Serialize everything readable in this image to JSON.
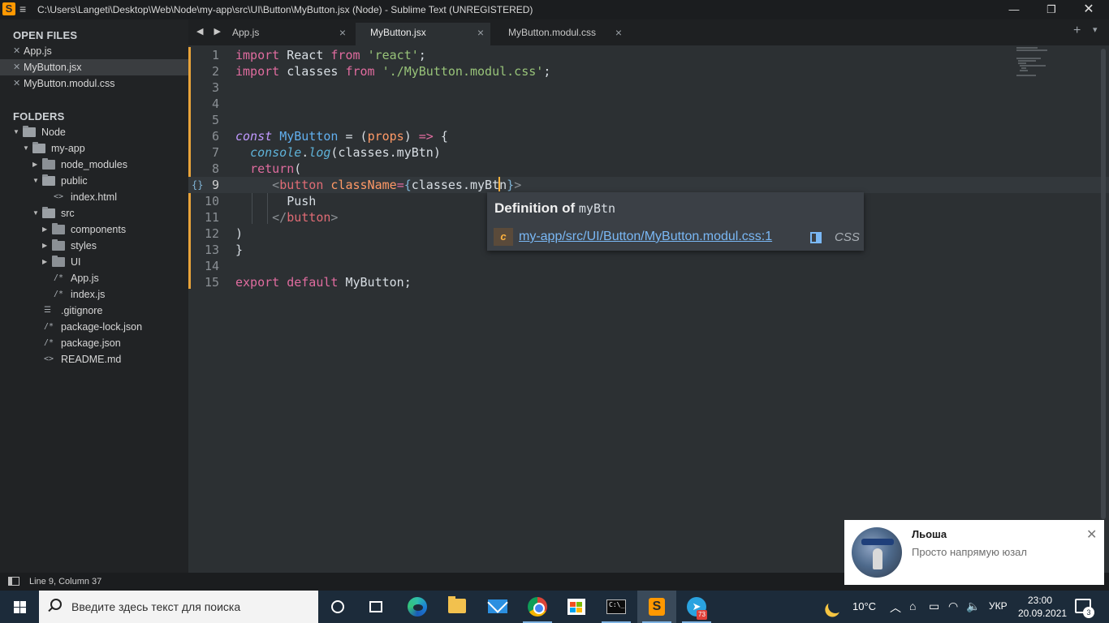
{
  "window": {
    "title": "C:\\Users\\Langeti\\Desktop\\Web\\Node\\my-app\\src\\UI\\Button\\MyButton.jsx (Node) - Sublime Text (UNREGISTERED)",
    "app_icon_glyph": "S",
    "menu_glyph": "≡",
    "minimize_glyph": "—",
    "maximize_glyph": "❐",
    "close_glyph": "✕"
  },
  "sidebar": {
    "open_files_heading": "OPEN FILES",
    "open_files": [
      {
        "label": "App.js",
        "active": false
      },
      {
        "label": "MyButton.jsx",
        "active": true
      },
      {
        "label": "MyButton.modul.css",
        "active": false
      }
    ],
    "close_glyph": "✕",
    "folders_heading": "FOLDERS",
    "tree": [
      {
        "label": "Node",
        "kind": "folder-open"
      },
      {
        "label": "my-app",
        "kind": "folder-open"
      },
      {
        "label": "node_modules",
        "kind": "folder"
      },
      {
        "label": "public",
        "kind": "folder-open"
      },
      {
        "label": "index.html",
        "kind": "file-markup",
        "icon_glyph": "<>"
      },
      {
        "label": "src",
        "kind": "folder-open"
      },
      {
        "label": "components",
        "kind": "folder"
      },
      {
        "label": "styles",
        "kind": "folder"
      },
      {
        "label": "UI",
        "kind": "folder"
      },
      {
        "label": "App.js",
        "kind": "file-script",
        "icon_glyph": "/*"
      },
      {
        "label": "index.js",
        "kind": "file-script",
        "icon_glyph": "/*"
      },
      {
        "label": ".gitignore",
        "kind": "file-text",
        "icon_glyph": "☰"
      },
      {
        "label": "package-lock.json",
        "kind": "file-script",
        "icon_glyph": "/*"
      },
      {
        "label": "package.json",
        "kind": "file-script",
        "icon_glyph": "/*"
      },
      {
        "label": "README.md",
        "kind": "file-markup",
        "icon_glyph": "<>"
      }
    ]
  },
  "tabs": {
    "nav_glyph": "◀ ▶",
    "items": [
      {
        "label": "App.js",
        "active": false
      },
      {
        "label": "MyButton.jsx",
        "active": true
      },
      {
        "label": "MyButton.modul.css",
        "active": false
      }
    ],
    "close_glyph": "×",
    "add_glyph": "+",
    "more_glyph": "▾"
  },
  "editor": {
    "current_line": 9,
    "line_numbers": [
      "1",
      "2",
      "3",
      "4",
      "5",
      "6",
      "7",
      "8",
      "9",
      "10",
      "11",
      "12",
      "13",
      "14",
      "15"
    ],
    "bracket_icon": "{}",
    "lines": [
      {
        "k1": "import",
        "t1": " React ",
        "k2": "from",
        "t2": " ",
        "s": "'react'",
        "t3": ";"
      },
      {
        "k1": "import",
        "t1": " classes ",
        "k2": "from",
        "t2": " ",
        "s": "'./MyButton.modul.css'",
        "t3": ";"
      },
      {},
      {},
      {},
      {
        "a": "const",
        "b": " ",
        "c": "MyButton",
        "d": " = (",
        "e": "props",
        "f": ") ",
        "g": "=>",
        "h": " {"
      },
      {
        "a": "console",
        "b": ".",
        "c": "log",
        "d": "(classes.myBtn)"
      },
      {
        "a": "return",
        "b": "("
      },
      {
        "a": "<",
        "b": "button",
        "c": " ",
        "d": "className",
        "e": "=",
        "f": "{",
        "g": "classes.myBt",
        "h": "n",
        "i": "}",
        "j": ">"
      },
      {
        "a": "Push"
      },
      {
        "a": "</",
        "b": "button",
        "c": ">"
      },
      {
        "a": ")"
      },
      {
        "a": "}"
      },
      {},
      {
        "a": "export",
        "b": " ",
        "c": "default",
        "d": " MyButton;"
      }
    ]
  },
  "popup": {
    "title": "Definition of",
    "symbol": "myBtn",
    "kind_letter": "c",
    "link": "my-app/src/UI/Button/MyButton.modul.css:1",
    "lang": "CSS"
  },
  "status": {
    "position": "Line 9, Column 37"
  },
  "notification": {
    "sender": "Льоша",
    "message": "Просто напрямую юзал",
    "close_glyph": "✕"
  },
  "taskbar": {
    "search_placeholder": "Введите здесь текст для поиска",
    "terminal_text": "C:\\_",
    "sublime_glyph": "S",
    "telegram_glyph": "➤",
    "telegram_badge": "73",
    "weather": "10°C",
    "tray_up_glyph": "︿",
    "tray_glyphs": [
      "⌂",
      "▭",
      "◠",
      "🔈"
    ],
    "language": "УКР",
    "time": "23:00",
    "date": "20.09.2021",
    "notification_count": "3",
    "colors": {
      "accent": "#ff9800",
      "cursor": "#ffb23e",
      "link": "#7ab8f5"
    }
  }
}
